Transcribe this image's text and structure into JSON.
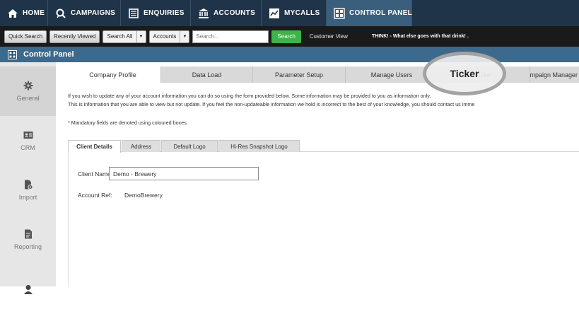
{
  "topnav": {
    "items": [
      {
        "label": "HOME",
        "icon": "home-icon"
      },
      {
        "label": "CAMPAIGNS",
        "icon": "campaigns-icon"
      },
      {
        "label": "ENQUIRIES",
        "icon": "enquiries-icon"
      },
      {
        "label": "ACCOUNTS",
        "icon": "accounts-icon"
      },
      {
        "label": "MYCALLS",
        "icon": "mycalls-icon"
      },
      {
        "label": "CONTROL PANEL",
        "icon": "control-panel-icon"
      }
    ],
    "active_index": 5
  },
  "searchbar": {
    "quick_search": "Quick Search",
    "recently_viewed": "Recently Viewed",
    "scope_select": "Search All",
    "type_select": "Accounts",
    "search_placeholder": "Search...",
    "search_button": "Search",
    "customer_view": "Customer View",
    "ticker_text": "THINK! - What else goes with that drink! ."
  },
  "panel": {
    "title": "Control Panel"
  },
  "rail": {
    "items": [
      {
        "label": "General",
        "icon": "gear-icon"
      },
      {
        "label": "CRM",
        "icon": "address-card-icon"
      },
      {
        "label": "Import",
        "icon": "import-file-icon"
      },
      {
        "label": "Reporting",
        "icon": "report-file-icon"
      },
      {
        "label": "",
        "icon": "user-icon"
      }
    ],
    "selected_index": 0
  },
  "tabs": [
    {
      "label": "Company Profile"
    },
    {
      "label": "Data Load"
    },
    {
      "label": "Parameter Setup"
    },
    {
      "label": "Manage Users"
    },
    {
      "label": "Ticker"
    },
    {
      "label": "Campaign Manager"
    }
  ],
  "intro": {
    "line1": "If you wish to update any of your account information you can do so using the form provided below. Some information may be provided to you as information only.",
    "line2": "This is information that you are able to view but not update. If you feel the non-updateable information we hold is incorrect to the best of your knowledge, you should contact us imme",
    "mandatory_note": "* Mandatory fields are denoted using coloured boxes."
  },
  "subtabs": [
    {
      "label": "Client Details"
    },
    {
      "label": "Address"
    },
    {
      "label": "Default Logo"
    },
    {
      "label": "Hi-Res Snapshot Logo"
    }
  ],
  "form": {
    "client_name_label": "Client Name:",
    "mandatory_marker": "*",
    "client_name_value": "Demo - Brewery",
    "account_ref_label": "Account Ref:",
    "account_ref_value": "DemoBrewery"
  },
  "highlight": {
    "label": "Ticker"
  },
  "colors": {
    "nav_bg": "#1f3448",
    "panel_header": "#3d6a8c",
    "search_green": "#3db34a",
    "mandatory_red": "#d92b2b"
  }
}
